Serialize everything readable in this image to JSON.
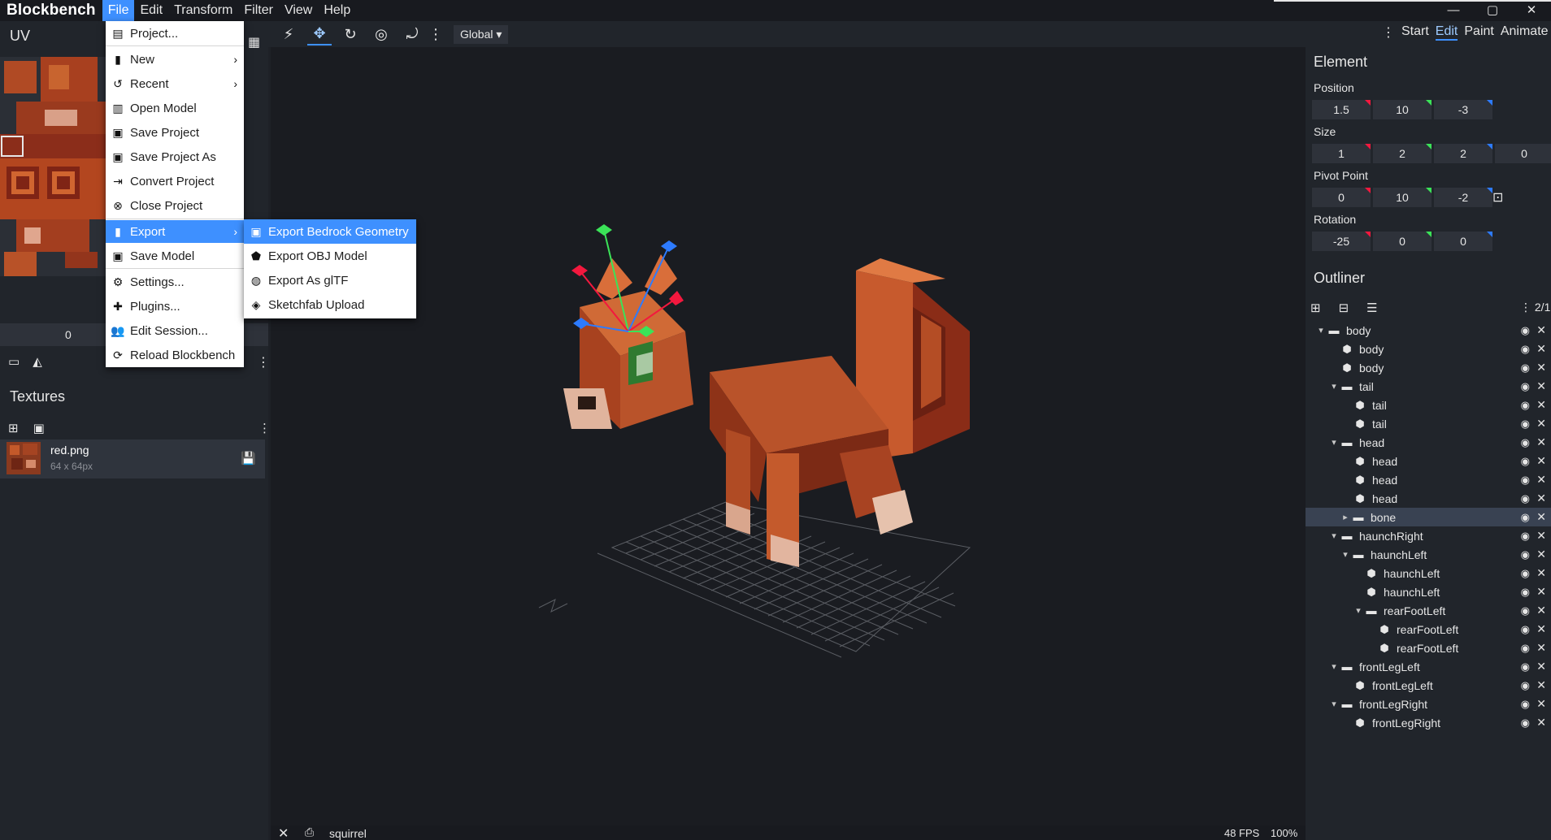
{
  "app": {
    "name": "Blockbench"
  },
  "menubar": {
    "items": [
      "File",
      "Edit",
      "Transform",
      "Filter",
      "View",
      "Help"
    ],
    "active": "File"
  },
  "window_controls": {
    "minimize": "—",
    "maximize": "▢",
    "close": "✕"
  },
  "toolbar": {
    "transform_space": "Global"
  },
  "modes": {
    "items": [
      "Start",
      "Edit",
      "Paint",
      "Animate"
    ],
    "active": "Edit"
  },
  "uv_panel": {
    "title": "UV",
    "value": "0"
  },
  "textures_panel": {
    "title": "Textures",
    "items": [
      {
        "name": "red.png",
        "size": "64 x 64px"
      }
    ]
  },
  "file_menu": {
    "items": [
      {
        "label": "Project...",
        "icon": "project-icon"
      },
      {
        "label": "New",
        "icon": "file-icon",
        "submenu": true
      },
      {
        "label": "Recent",
        "icon": "history-icon",
        "submenu": true
      },
      {
        "label": "Open Model",
        "icon": "bar-chart-icon"
      },
      {
        "label": "Save Project",
        "icon": "save-icon"
      },
      {
        "label": "Save Project As",
        "icon": "save-icon"
      },
      {
        "label": "Convert Project",
        "icon": "convert-icon"
      },
      {
        "label": "Close Project",
        "icon": "close-circle-icon"
      },
      {
        "label": "Export",
        "icon": "file-icon",
        "submenu": true,
        "highlight": true
      },
      {
        "label": "Save Model",
        "icon": "save-icon"
      },
      {
        "label": "Settings...",
        "icon": "gear-icon"
      },
      {
        "label": "Plugins...",
        "icon": "puzzle-icon"
      },
      {
        "label": "Edit Session...",
        "icon": "users-icon"
      },
      {
        "label": "Reload Blockbench",
        "icon": "reload-icon"
      }
    ]
  },
  "export_menu": {
    "items": [
      {
        "label": "Export Bedrock Geometry",
        "icon": "bedrock-icon",
        "highlight": true
      },
      {
        "label": "Export OBJ Model",
        "icon": "obj-icon"
      },
      {
        "label": "Export As glTF",
        "icon": "gltf-icon"
      },
      {
        "label": "Sketchfab Upload",
        "icon": "sketchfab-icon"
      }
    ]
  },
  "element_panel": {
    "title": "Element",
    "position": {
      "label": "Position",
      "values": [
        "1.5",
        "10",
        "-3"
      ]
    },
    "size": {
      "label": "Size",
      "values": [
        "1",
        "2",
        "2",
        "0"
      ]
    },
    "pivot": {
      "label": "Pivot Point",
      "values": [
        "0",
        "10",
        "-2"
      ]
    },
    "rotation": {
      "label": "Rotation",
      "values": [
        "-25",
        "0",
        "0"
      ]
    }
  },
  "outliner": {
    "title": "Outliner",
    "count": "2/1",
    "rows": [
      {
        "label": "body",
        "type": "group",
        "depth": 0,
        "expanded": true
      },
      {
        "label": "body",
        "type": "cube",
        "depth": 1
      },
      {
        "label": "body",
        "type": "cube",
        "depth": 1
      },
      {
        "label": "tail",
        "type": "group",
        "depth": 1,
        "expanded": true
      },
      {
        "label": "tail",
        "type": "cube",
        "depth": 2
      },
      {
        "label": "tail",
        "type": "cube",
        "depth": 2
      },
      {
        "label": "head",
        "type": "group",
        "depth": 1,
        "expanded": true
      },
      {
        "label": "head",
        "type": "cube",
        "depth": 2
      },
      {
        "label": "head",
        "type": "cube",
        "depth": 2
      },
      {
        "label": "head",
        "type": "cube",
        "depth": 2
      },
      {
        "label": "bone",
        "type": "group",
        "depth": 2,
        "expanded": false,
        "selected": true
      },
      {
        "label": "haunchRight",
        "type": "group",
        "depth": 1,
        "expanded": true
      },
      {
        "label": "haunchLeft",
        "type": "group",
        "depth": 2,
        "expanded": true
      },
      {
        "label": "haunchLeft",
        "type": "cube",
        "depth": 3
      },
      {
        "label": "haunchLeft",
        "type": "cube",
        "depth": 3
      },
      {
        "label": "rearFootLeft",
        "type": "group",
        "depth": 3,
        "expanded": true
      },
      {
        "label": "rearFootLeft",
        "type": "cube",
        "depth": 4
      },
      {
        "label": "rearFootLeft",
        "type": "cube",
        "depth": 4
      },
      {
        "label": "frontLegLeft",
        "type": "group",
        "depth": 1,
        "expanded": true
      },
      {
        "label": "frontLegLeft",
        "type": "cube",
        "depth": 2
      },
      {
        "label": "frontLegRight",
        "type": "group",
        "depth": 1,
        "expanded": true
      },
      {
        "label": "frontLegRight",
        "type": "cube",
        "depth": 2
      }
    ]
  },
  "statusbar": {
    "model_name": "squirrel",
    "fps": "48 FPS",
    "zoom": "100%"
  }
}
